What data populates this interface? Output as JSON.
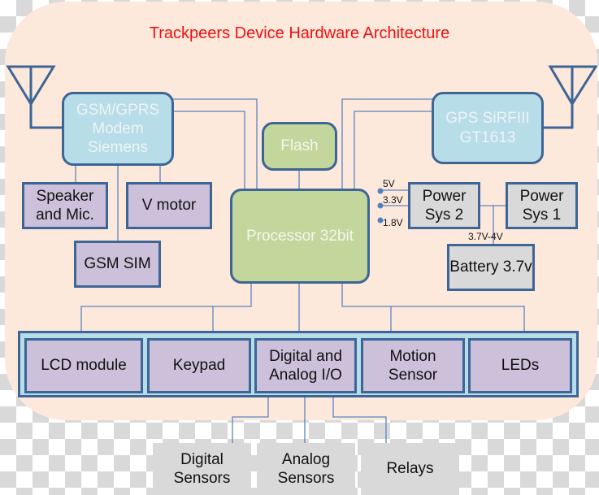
{
  "title": "Trackpeers Device Hardware Architecture",
  "colors": {
    "title": "#ee1111",
    "panel": "#fde9db",
    "border": "#3d6596",
    "modem_fill": "#b7dde8",
    "processor_fill": "#c3d69b",
    "peripheral_fill": "#ccc0da",
    "power_fill": "#d9d9d9"
  },
  "modules": {
    "gsm_modem": "GSM/GPRS Modem Siemens",
    "gps": "GPS SiRFIII GT1613",
    "flash": "Flash",
    "processor": "Processor 32bit",
    "speaker": "Speaker and Mic.",
    "vmotor": "V motor",
    "sim": "GSM SIM",
    "power2": "Power Sys 2",
    "power1": "Power Sys 1",
    "battery": "Battery 3.7v"
  },
  "voltages": {
    "v5": "5V",
    "v33": "3.3V",
    "v18": "1.8V",
    "battery_range": "3.7V-4V"
  },
  "bus_modules": [
    "LCD module",
    "Keypad",
    "Digital and Analog I/O",
    "Motion Sensor",
    "LEDs"
  ],
  "external": [
    "Digital Sensors",
    "Analog Sensors",
    "Relays"
  ]
}
